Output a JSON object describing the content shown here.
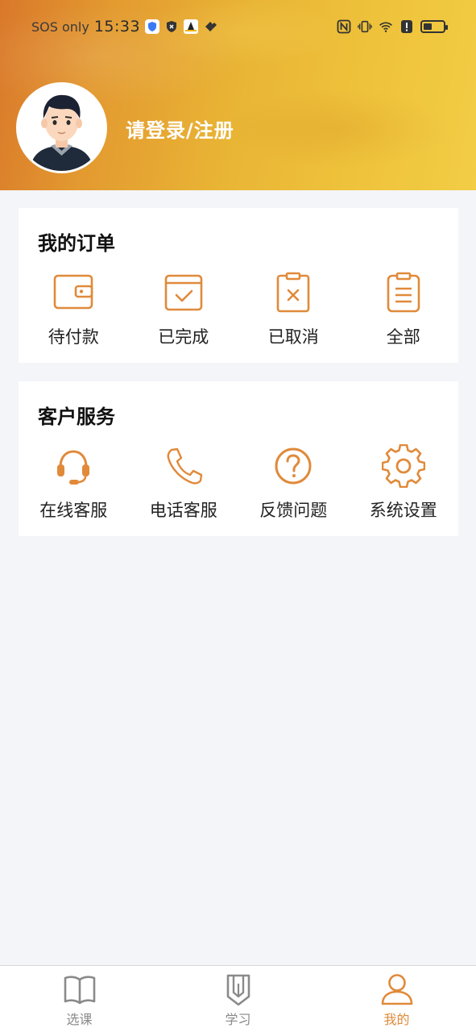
{
  "status_bar": {
    "carrier": "SOS only",
    "time": "15:33"
  },
  "profile": {
    "login_label": "请登录/注册",
    "avatar": "user-avatar-illustration"
  },
  "orders": {
    "title": "我的订单",
    "items": [
      {
        "label": "待付款",
        "icon": "wallet-icon"
      },
      {
        "label": "已完成",
        "icon": "calendar-check-icon"
      },
      {
        "label": "已取消",
        "icon": "clipboard-x-icon"
      },
      {
        "label": "全部",
        "icon": "clipboard-list-icon"
      }
    ]
  },
  "service": {
    "title": "客户服务",
    "items": [
      {
        "label": "在线客服",
        "icon": "headset-icon"
      },
      {
        "label": "电话客服",
        "icon": "phone-icon"
      },
      {
        "label": "反馈问题",
        "icon": "question-circle-icon"
      },
      {
        "label": "系统设置",
        "icon": "gear-icon"
      }
    ]
  },
  "tabbar": {
    "items": [
      {
        "label": "选课",
        "icon": "book-icon",
        "active": false
      },
      {
        "label": "学习",
        "icon": "pencil-icon",
        "active": false
      },
      {
        "label": "我的",
        "icon": "person-icon",
        "active": true
      }
    ]
  },
  "colors": {
    "accent": "#e08a3a",
    "header_start": "#d9782a",
    "header_end": "#f2cd45",
    "background": "#f4f5f9"
  }
}
